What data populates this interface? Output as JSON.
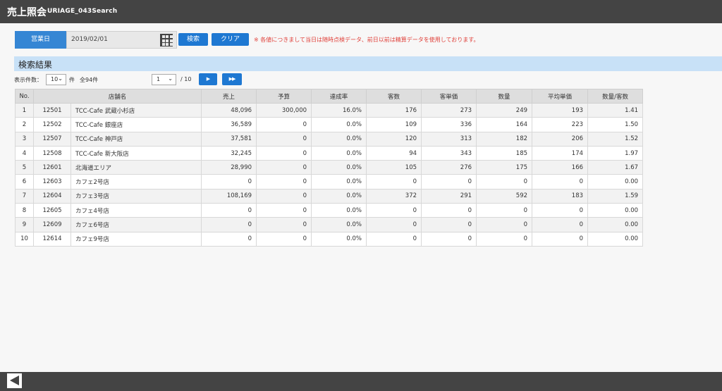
{
  "header": {
    "title": "売上照会",
    "subtitle": "URIAGE_043Search"
  },
  "search": {
    "date_label": "営業日",
    "date_value": "2019/02/01",
    "search_button": "検索",
    "clear_button": "クリア",
    "notice": "※ 各値につきまして当日は随時点検データ、前日以前は精算データを使用しております。"
  },
  "results": {
    "section_title": "検索結果",
    "per_page_label": "表示件数：",
    "per_page_value": "10",
    "per_page_unit": "件",
    "total_label": "全94件",
    "page_value": "1",
    "page_total": "/ 10",
    "next_button": "▶",
    "last_button": "▶▶",
    "columns": [
      "No.",
      "店舗名",
      "売上",
      "予算",
      "達成率",
      "客数",
      "客単価",
      "数量",
      "平均単価",
      "数量/客数"
    ],
    "rows": [
      [
        "1",
        "12501",
        "TCC-Cafe 武蔵小杉店",
        "48,096",
        "300,000",
        "16.0%",
        "176",
        "273",
        "249",
        "193",
        "1.41"
      ],
      [
        "2",
        "12502",
        "TCC-Cafe 銀座店",
        "36,589",
        "0",
        "0.0%",
        "109",
        "336",
        "164",
        "223",
        "1.50"
      ],
      [
        "3",
        "12507",
        "TCC-Cafe 神戸店",
        "37,581",
        "0",
        "0.0%",
        "120",
        "313",
        "182",
        "206",
        "1.52"
      ],
      [
        "4",
        "12508",
        "TCC-Cafe 新大阪店",
        "32,245",
        "0",
        "0.0%",
        "94",
        "343",
        "185",
        "174",
        "1.97"
      ],
      [
        "5",
        "12601",
        "北海道エリア",
        "28,990",
        "0",
        "0.0%",
        "105",
        "276",
        "175",
        "166",
        "1.67"
      ],
      [
        "6",
        "12603",
        "カフェ2号店",
        "0",
        "0",
        "0.0%",
        "0",
        "0",
        "0",
        "0",
        "0.00"
      ],
      [
        "7",
        "12604",
        "カフェ3号店",
        "108,169",
        "0",
        "0.0%",
        "372",
        "291",
        "592",
        "183",
        "1.59"
      ],
      [
        "8",
        "12605",
        "カフェ4号店",
        "0",
        "0",
        "0.0%",
        "0",
        "0",
        "0",
        "0",
        "0.00"
      ],
      [
        "9",
        "12609",
        "カフェ6号店",
        "0",
        "0",
        "0.0%",
        "0",
        "0",
        "0",
        "0",
        "0.00"
      ],
      [
        "10",
        "12614",
        "カフェ9号店",
        "0",
        "0",
        "0.0%",
        "0",
        "0",
        "0",
        "0",
        "0.00"
      ]
    ]
  },
  "colors": {
    "accent": "#1e78d2",
    "header_bg": "#444444",
    "section_bg": "#c8e1f7",
    "notice": "#e0403a"
  }
}
